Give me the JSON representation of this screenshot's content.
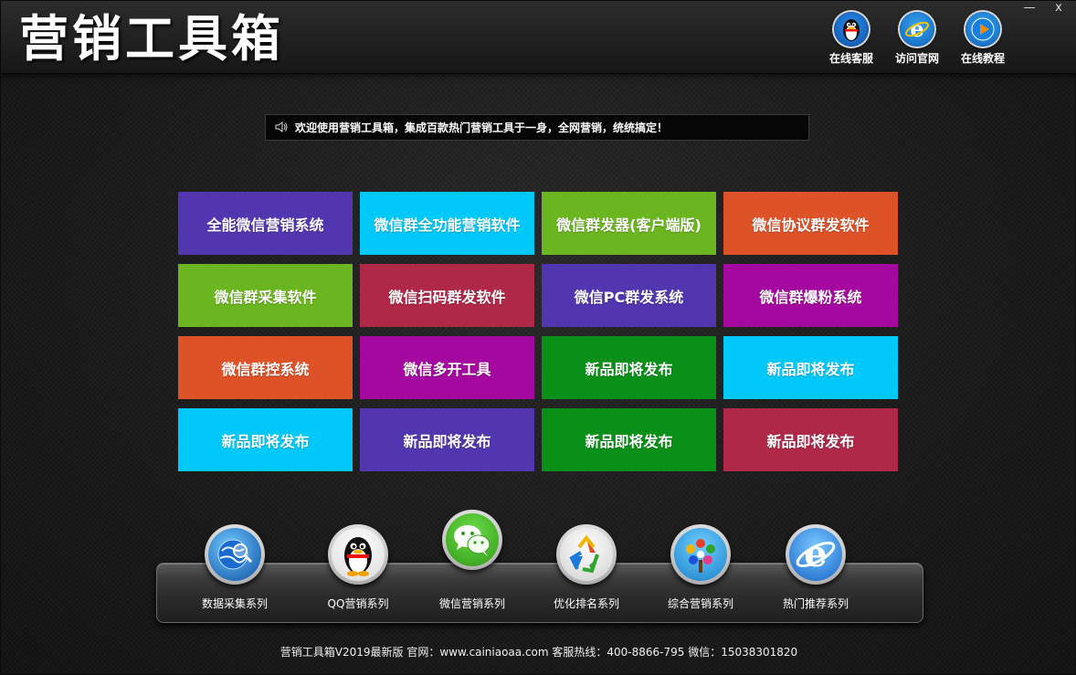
{
  "window": {
    "title": "营销工具箱",
    "minimize_label": "—",
    "close_label": "x"
  },
  "header_tools": [
    {
      "label": "在线客服",
      "icon": "qq-penguin-icon"
    },
    {
      "label": "访问官网",
      "icon": "ie-browser-icon"
    },
    {
      "label": "在线教程",
      "icon": "play-icon"
    }
  ],
  "notice": {
    "icon": "speaker-icon",
    "text": "欢迎使用营销工具箱，集成百款热门营销工具于一身，全网营销，统统搞定！"
  },
  "tiles": [
    {
      "label": "全能微信营销系统",
      "color": "#5236b0"
    },
    {
      "label": "微信群全功能营销软件",
      "color": "#00c8f8"
    },
    {
      "label": "微信群发器(客户端版)",
      "color": "#6ab520"
    },
    {
      "label": "微信协议群发软件",
      "color": "#de5228"
    },
    {
      "label": "微信群采集软件",
      "color": "#6ab520"
    },
    {
      "label": "微信扫码群发软件",
      "color": "#b02848"
    },
    {
      "label": "微信PC群发系统",
      "color": "#5236b0"
    },
    {
      "label": "微信群爆粉系统",
      "color": "#a4089e"
    },
    {
      "label": "微信群控系统",
      "color": "#de5228"
    },
    {
      "label": "微信多开工具",
      "color": "#a4089e"
    },
    {
      "label": "新品即将发布",
      "color": "#0a9018"
    },
    {
      "label": "新品即将发布",
      "color": "#00c8f8"
    },
    {
      "label": "新品即将发布",
      "color": "#00c8f8"
    },
    {
      "label": "新品即将发布",
      "color": "#5236b0"
    },
    {
      "label": "新品即将发布",
      "color": "#0a9018"
    },
    {
      "label": "新品即将发布",
      "color": "#b02848"
    }
  ],
  "dock": [
    {
      "label": "数据采集系列",
      "icon": "globe-magnifier-icon"
    },
    {
      "label": "QQ营销系列",
      "icon": "qq-penguin-icon"
    },
    {
      "label": "微信营销系列",
      "icon": "wechat-icon"
    },
    {
      "label": "优化排名系列",
      "icon": "seo-recycle-icon"
    },
    {
      "label": "综合营销系列",
      "icon": "social-tree-icon"
    },
    {
      "label": "热门推荐系列",
      "icon": "ie-browser-icon"
    }
  ],
  "footer": {
    "text": "营销工具箱V2019最新版 官网：www.cainiaoaa.com 客服热线：400-8866-795 微信：15038301820"
  }
}
